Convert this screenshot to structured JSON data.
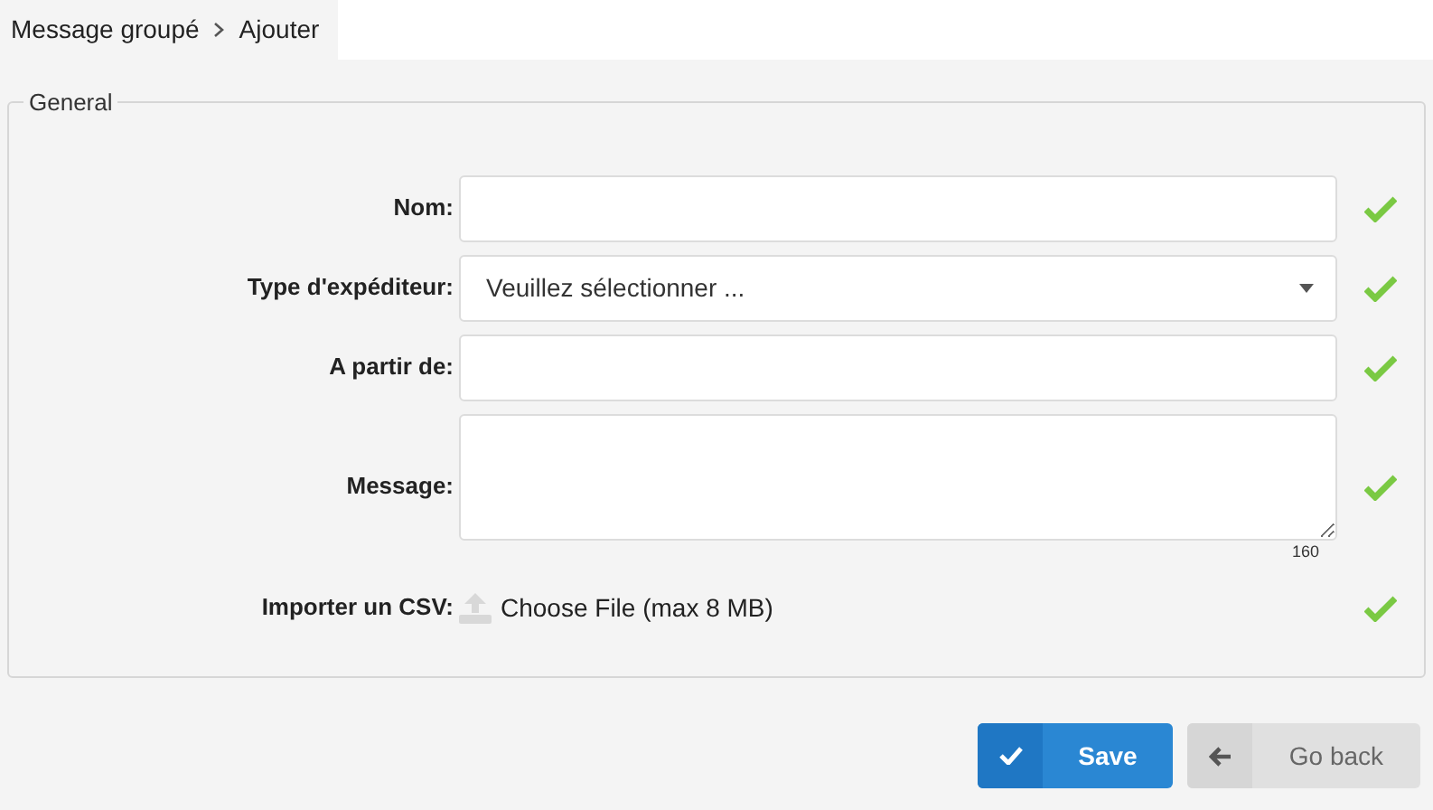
{
  "breadcrumb": [
    "Message groupé",
    "Ajouter"
  ],
  "fieldset": {
    "legend": "General",
    "fields": [
      {
        "kind": "text",
        "label": "Nom:",
        "valid": true
      },
      {
        "kind": "select",
        "label": "Type d'expéditeur:",
        "value": "Veuillez sélectionner ...",
        "valid": true
      },
      {
        "kind": "text",
        "label": "A partir de:",
        "valid": true
      },
      {
        "kind": "textarea",
        "label": "Message:",
        "counter": "160",
        "valid": true
      },
      {
        "kind": "file",
        "label": "Importer un CSV:",
        "button": "Choose File (max 8 MB)",
        "valid": true
      }
    ]
  },
  "buttons": [
    {
      "kind": "primary",
      "label": "Save"
    },
    {
      "kind": "secondary",
      "label": "Go back"
    }
  ]
}
